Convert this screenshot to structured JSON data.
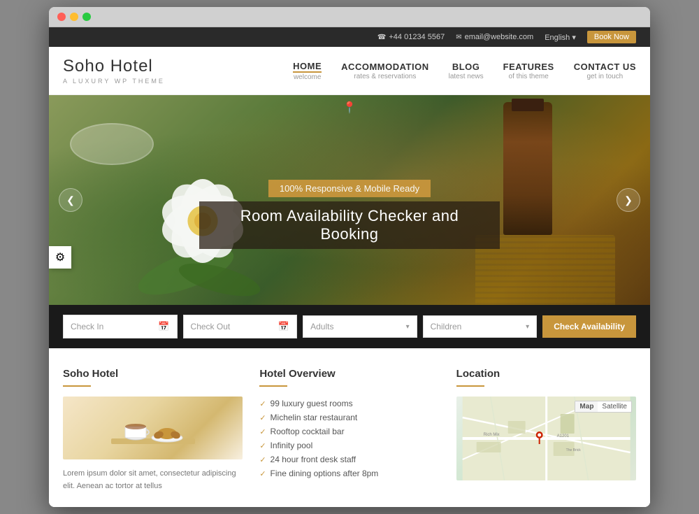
{
  "browser": {
    "dots": [
      "red",
      "yellow",
      "green"
    ]
  },
  "topbar": {
    "phone": "+44 01234 5567",
    "email": "email@website.com",
    "language": "English",
    "book_now": "Book Now"
  },
  "header": {
    "logo_title": "Soho Hotel",
    "logo_subtitle": "A Luxury WP Theme",
    "location_pin": "📍"
  },
  "nav": {
    "items": [
      {
        "main": "HOME",
        "sub": "welcome",
        "active": true
      },
      {
        "main": "ACCOMMODATION",
        "sub": "rates & reservations",
        "active": false
      },
      {
        "main": "BLOG",
        "sub": "latest news",
        "active": false
      },
      {
        "main": "FEATURES",
        "sub": "of this theme",
        "active": false
      },
      {
        "main": "CONTACT US",
        "sub": "get in touch",
        "active": false
      }
    ]
  },
  "hero": {
    "badge": "100% Responsive & Mobile Ready",
    "title": "Room Availability Checker and Booking",
    "prev_arrow": "❮",
    "next_arrow": "❯"
  },
  "booking": {
    "checkin_placeholder": "Check In",
    "checkout_placeholder": "Check Out",
    "adults_placeholder": "Adults",
    "children_placeholder": "Children",
    "check_btn": "Check Availability"
  },
  "soho_section": {
    "title": "Soho Hotel",
    "description": "Lorem ipsum dolor sit amet, consectetur adipiscing elit. Aenean ac tortor at tellus"
  },
  "overview_section": {
    "title": "Hotel Overview",
    "items": [
      "99 luxury guest rooms",
      "Michelin star restaurant",
      "Rooftop cocktail bar",
      "Infinity pool",
      "24 hour front desk staff",
      "Fine dining options after 8pm"
    ]
  },
  "location_section": {
    "title": "Location",
    "map_btn1": "Map",
    "map_btn2": "Satellite"
  },
  "settings": {
    "icon": "⚙"
  }
}
